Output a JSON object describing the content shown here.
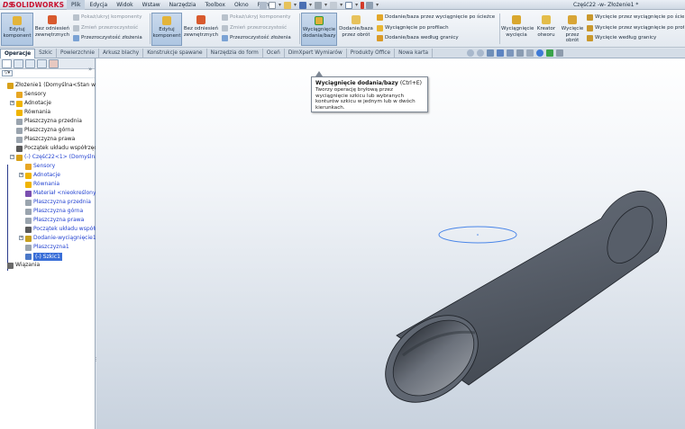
{
  "app": {
    "logo_prefix": "DS",
    "logo_text": "SOLIDWORKS",
    "doc_title": "Część22 -w- Złożenie1 *"
  },
  "menu": [
    "Plik",
    "Edycja",
    "Widok",
    "Wstaw",
    "Narzędzia",
    "Toolbox",
    "Okno",
    "Pomoc"
  ],
  "ribbon": {
    "group1": {
      "edit_component": "Edytuj komponent",
      "no_external": "Bez odniesień zewnętrznych",
      "show_hide": "Pokaż/ukryj komponenty",
      "change_transparency": "Zmień przezroczystość",
      "assembly_transparency": "Przezroczystość złożenia"
    },
    "group2": {
      "edit_component": "Edytuj komponent",
      "no_external": "Bez odniesień zewnętrznych",
      "show_hide": "Pokaż/ukryj komponenty",
      "change_transparency": "Zmień przezroczystość",
      "assembly_transparency": "Przezroczystość złożenia"
    },
    "features": {
      "extrude_boss": "Wyciągnięcie dodania/bazy",
      "revolve_boss": "Dodanie/baza przez obrót",
      "sweep_boss": "Dodanie/baza przez wyciągnięcie po ścieżce",
      "loft_boss": "Wyciągnięcie po profilach",
      "boundary_boss": "Dodanie/baza według granicy",
      "extrude_cut": "Wyciągnięcie wycięcia",
      "hole_wizard": "Kreator otworu",
      "revolve_cut": "Wycięcie przez obrót",
      "sweep_cut": "Wycięcie przez wyciągnięcie po ścieżce",
      "loft_cut": "Wycięcie przez wyciągnięcie po profi",
      "boundary_cut": "Wycięcie według granicy"
    }
  },
  "tabs": [
    "Operacje",
    "Szkic",
    "Powierzchnie",
    "Arkusz blachy",
    "Konstrukcje spawane",
    "Narzędzia do form",
    "Oceń",
    "DimXpert Wymiarów",
    "Produkty Office",
    "Nowa karta"
  ],
  "tooltip": {
    "title": "Wyciągnięcie dodania/bazy",
    "shortcut": "(Ctrl+E)",
    "body": "Tworzy operację bryłową przez wyciągnięcie szkicu lub wybranych konturów szkicu w jednym lub w dwóch kierunkach."
  },
  "tree": [
    {
      "label": "Złożenie1  (Domyślna<Stan wy",
      "level": 0,
      "toggle": "",
      "icon": "assembly-icon",
      "color": "#d8a11a"
    },
    {
      "label": "Sensory",
      "level": 1,
      "toggle": "",
      "icon": "sensors-icon",
      "color": "#e7a623"
    },
    {
      "label": "Adnotacje",
      "level": 1,
      "toggle": "+",
      "icon": "annotations-icon",
      "color": "#f0b400"
    },
    {
      "label": "Równania",
      "level": 1,
      "toggle": "",
      "icon": "equations-icon",
      "color": "#f0b400"
    },
    {
      "label": "Płaszczyzna przednia",
      "level": 1,
      "toggle": "",
      "icon": "plane-icon",
      "color": "#9aa4ae"
    },
    {
      "label": "Płaszczyzna górna",
      "level": 1,
      "toggle": "",
      "icon": "plane-icon",
      "color": "#9aa4ae"
    },
    {
      "label": "Płaszczyzna prawa",
      "level": 1,
      "toggle": "",
      "icon": "plane-icon",
      "color": "#9aa4ae"
    },
    {
      "label": "Początek układu współrzęd",
      "level": 1,
      "toggle": "",
      "icon": "origin-icon",
      "color": "#5a5a5a"
    },
    {
      "label": "(-) Część22<1> (Domyślna-",
      "level": 1,
      "toggle": "−",
      "icon": "part-icon",
      "color": "#d8a11a",
      "sub": true
    },
    {
      "label": "Sensory",
      "level": 2,
      "toggle": "",
      "icon": "sensors-icon",
      "color": "#e7a623",
      "sub": true
    },
    {
      "label": "Adnotacje",
      "level": 2,
      "toggle": "+",
      "icon": "annotations-icon",
      "color": "#f0b400",
      "sub": true
    },
    {
      "label": "Równania",
      "level": 2,
      "toggle": "",
      "icon": "equations-icon",
      "color": "#f0b400",
      "sub": true
    },
    {
      "label": "Materiał <nieokreślony>",
      "level": 2,
      "toggle": "",
      "icon": "material-icon",
      "color": "#7a4fb0",
      "sub": true
    },
    {
      "label": "Płaszczyzna przednia",
      "level": 2,
      "toggle": "",
      "icon": "plane-icon",
      "color": "#9aa4ae",
      "sub": true
    },
    {
      "label": "Płaszczyzna górna",
      "level": 2,
      "toggle": "",
      "icon": "plane-icon",
      "color": "#9aa4ae",
      "sub": true
    },
    {
      "label": "Płaszczyzna prawa",
      "level": 2,
      "toggle": "",
      "icon": "plane-icon",
      "color": "#9aa4ae",
      "sub": true
    },
    {
      "label": "Początek układu współr",
      "level": 2,
      "toggle": "",
      "icon": "origin-icon",
      "color": "#5a5a5a",
      "sub": true
    },
    {
      "label": "Dodanie-wyciągnięcie1",
      "level": 2,
      "toggle": "+",
      "icon": "extrude-feature-icon",
      "color": "#c8a020",
      "sub": true
    },
    {
      "label": "Płaszczyzna1",
      "level": 2,
      "toggle": "",
      "icon": "plane-icon",
      "color": "#9aa4ae",
      "sub": true
    },
    {
      "label": "(-) Szkic1",
      "level": 2,
      "toggle": "",
      "icon": "sketch-icon",
      "color": "#4a78c8",
      "sub": true,
      "selected": true
    },
    {
      "label": "Wiązania",
      "level": 0,
      "toggle": "",
      "icon": "mates-icon",
      "color": "#6a6a6a"
    }
  ],
  "colors": {
    "accent": "#3a6fd8",
    "tube": "#5c6470",
    "sketch_ellipse": "#4a86e8"
  }
}
